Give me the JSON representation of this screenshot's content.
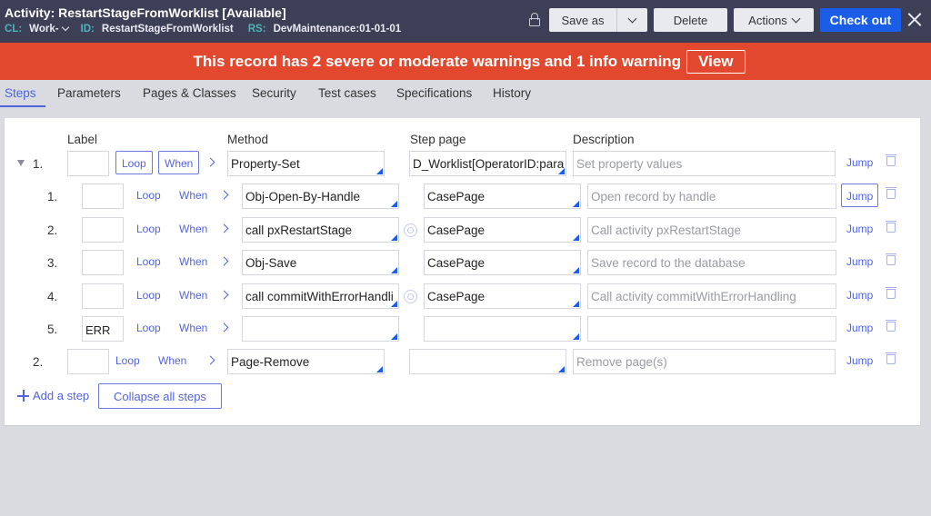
{
  "header": {
    "title": "Activity: RestartStageFromWorklist [Available]",
    "meta": [
      {
        "key": "CL:",
        "value": "Work-"
      },
      {
        "key": "ID:",
        "value": "RestartStageFromWorklist"
      },
      {
        "key": "RS:",
        "value": "DevMaintenance:01-01-01"
      }
    ],
    "buttons": {
      "save_as": "Save as",
      "delete": "Delete",
      "actions": "Actions",
      "check_out": "Check out"
    }
  },
  "banner": {
    "text": "This record has 2 severe or moderate warnings and 1 info warning",
    "view": "View"
  },
  "tabs": [
    "Steps",
    "Parameters",
    "Pages & Classes",
    "Security",
    "Test cases",
    "Specifications",
    "History"
  ],
  "active_tab": "Steps",
  "columns": {
    "label": "Label",
    "method": "Method",
    "step_page": "Step page",
    "description": "Description"
  },
  "steps": [
    {
      "num": "1.",
      "level": 0,
      "expanded": true,
      "label": "",
      "loop": "Loop",
      "when": "When",
      "method": "Property-Set",
      "step_page": "D_Worklist[OperatorID:para",
      "description": "Set property values",
      "description_placeholder": true,
      "jump": "Jump",
      "target_icon": false
    },
    {
      "num": "1.",
      "level": 1,
      "label": "",
      "loop": "Loop",
      "when": "When",
      "method": "Obj-Open-By-Handle",
      "step_page": "CasePage",
      "description": "Open record by handle",
      "description_placeholder": true,
      "jump": "Jump",
      "target_icon": false
    },
    {
      "num": "2.",
      "level": 1,
      "label": "",
      "loop": "Loop",
      "when": "When",
      "method": "call pxRestartStage",
      "step_page": "CasePage",
      "description": "Call activity pxRestartStage",
      "description_placeholder": true,
      "jump": "Jump",
      "target_icon": true
    },
    {
      "num": "3.",
      "level": 1,
      "label": "",
      "loop": "Loop",
      "when": "When",
      "method": "Obj-Save",
      "step_page": "CasePage",
      "description": "Save record to the database",
      "description_placeholder": true,
      "jump": "Jump",
      "target_icon": false
    },
    {
      "num": "4.",
      "level": 1,
      "label": "",
      "loop": "Loop",
      "when": "When",
      "method": "call commitWithErrorHandli",
      "step_page": "CasePage",
      "description": "Call activity commitWithErrorHandling",
      "description_placeholder": true,
      "jump": "Jump",
      "target_icon": true
    },
    {
      "num": "5.",
      "level": 1,
      "label": "ERR",
      "loop": "Loop",
      "when": "When",
      "method": "",
      "step_page": "",
      "description": "",
      "description_placeholder": false,
      "jump": "Jump",
      "target_icon": false
    },
    {
      "num": "2.",
      "level": 0,
      "label": "",
      "loop": "Loop",
      "when": "When",
      "method": "Page-Remove",
      "step_page": "",
      "description": "Remove page(s)",
      "description_placeholder": true,
      "jump": "Jump",
      "target_icon": false
    }
  ],
  "footer": {
    "add_step": "Add a step",
    "collapse_all": "Collapse all steps"
  },
  "colors": {
    "header_bg": "#3c3f55",
    "banner_bg": "#e2482e",
    "primary": "#1a5ee8",
    "link": "#5364dc",
    "page_bg": "#dadbe0"
  }
}
